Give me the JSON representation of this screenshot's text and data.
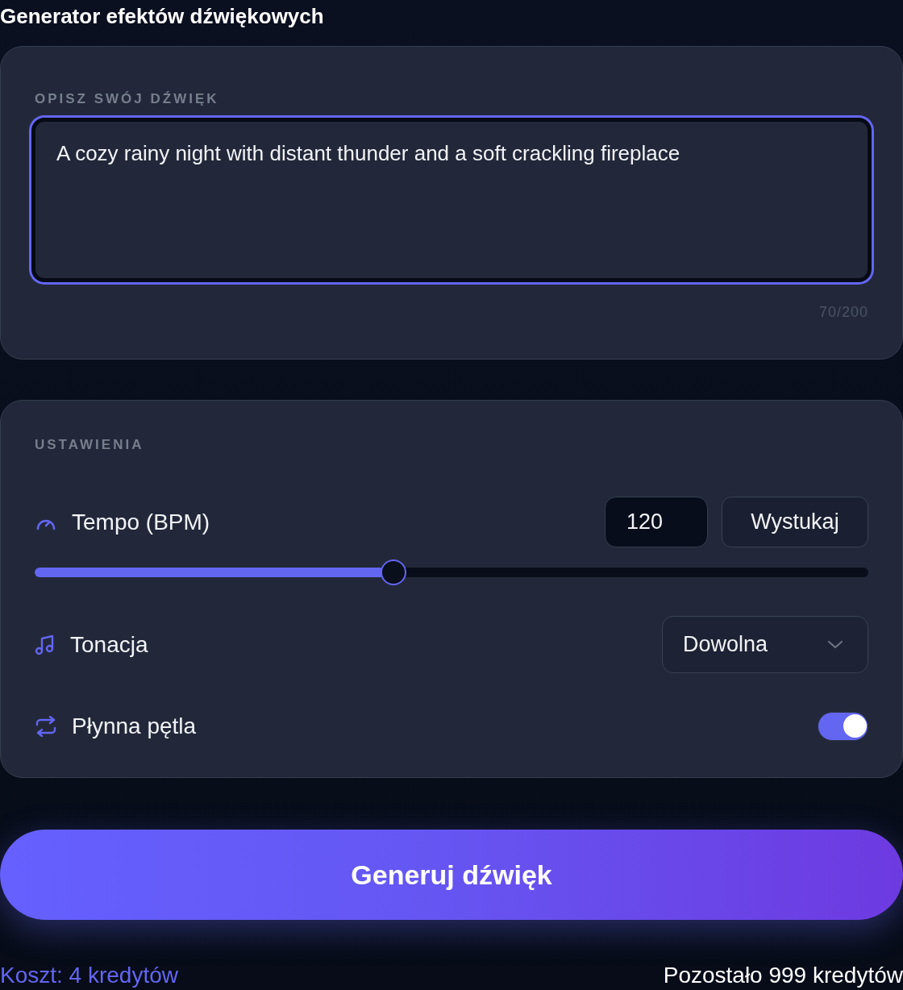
{
  "title": "Generator efektów dźwiękowych",
  "description": {
    "label": "OPISZ SWÓJ DŹWIĘK",
    "value": "A cozy rainy night with distant thunder and a soft crackling fireplace",
    "focused": true,
    "counter": "70/200"
  },
  "settings": {
    "label": "USTAWIENIA",
    "rows": [
      {
        "kind": "tempo",
        "label": "Tempo (BPM)",
        "value": "120",
        "button": "Wystukaj",
        "level": 0.43
      },
      {
        "kind": "select",
        "label": "Tonacja",
        "value": "Dowolna"
      },
      {
        "kind": "toggle",
        "label": "Płynna pętla",
        "on": true
      }
    ]
  },
  "generate_button": "Generuj dźwięk",
  "footer": {
    "cost": "Koszt: 4 kredytów",
    "remaining": "Pozostało 999 kredytów"
  }
}
